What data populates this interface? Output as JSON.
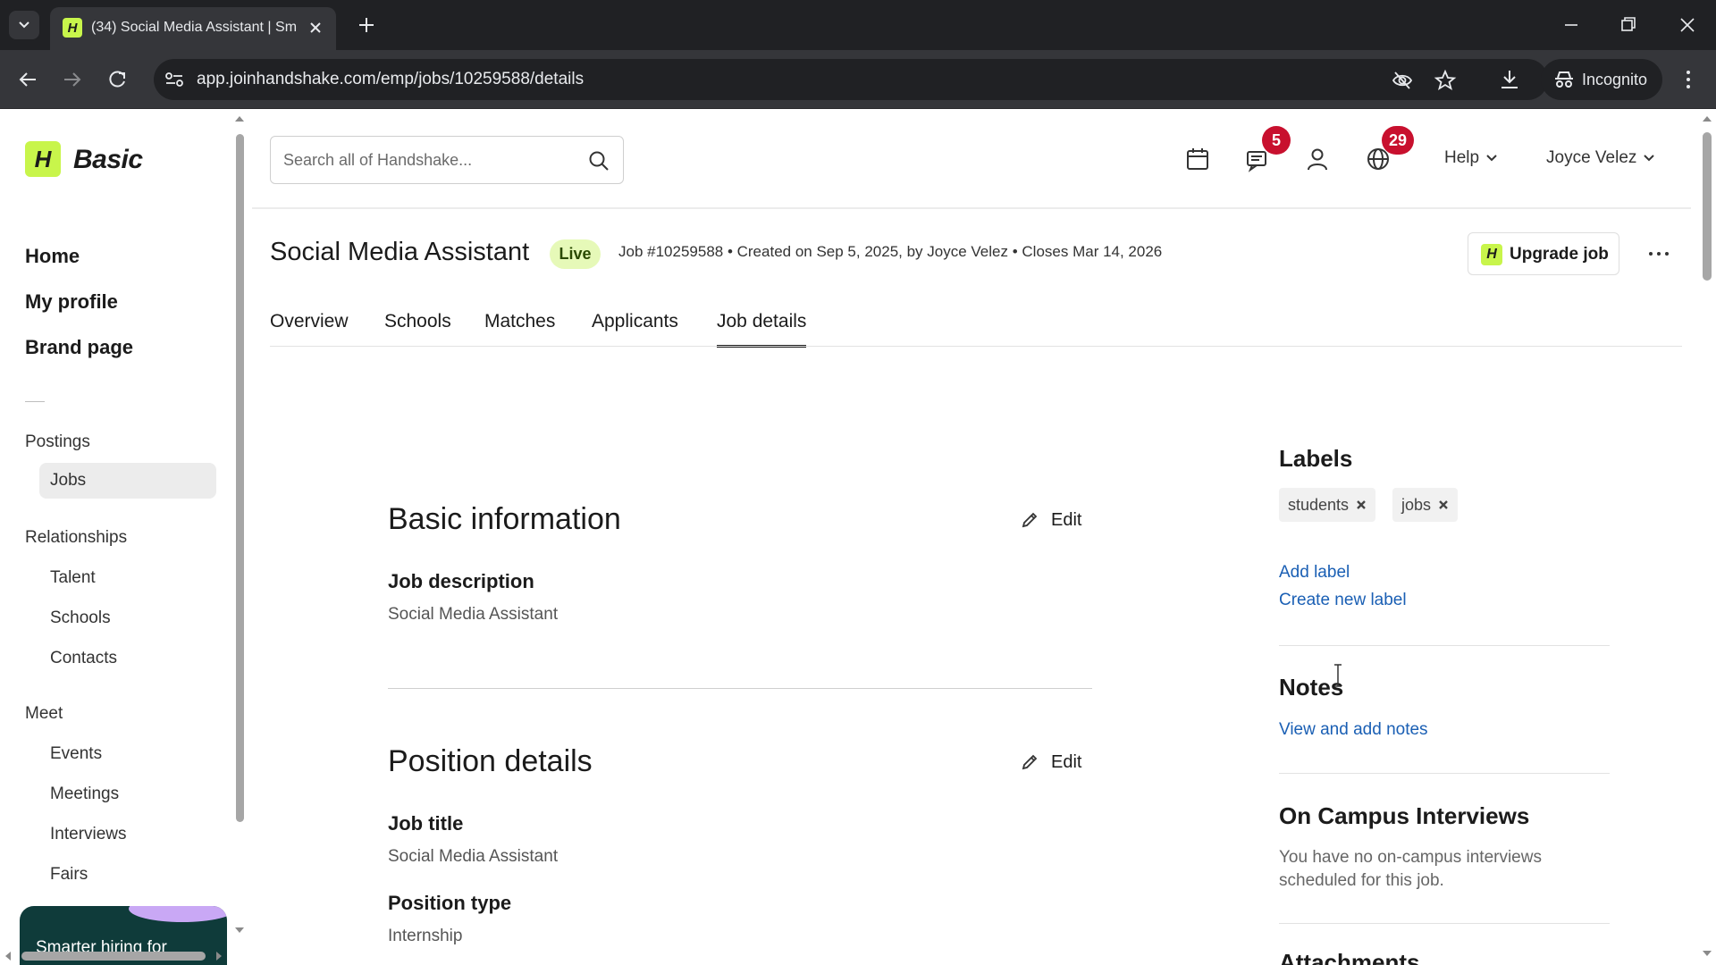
{
  "browser": {
    "tab_title": "(34) Social Media Assistant | Sm",
    "url": "app.joinhandshake.com/emp/jobs/10259588/details",
    "incognito_label": "Incognito"
  },
  "sidebar": {
    "brand_mark": "H",
    "brand_name": "Basic",
    "main": [
      {
        "label": "Home"
      },
      {
        "label": "My profile"
      },
      {
        "label": "Brand page"
      }
    ],
    "postings": {
      "title": "Postings",
      "items": [
        {
          "label": "Jobs"
        }
      ]
    },
    "relationships": {
      "title": "Relationships",
      "items": [
        {
          "label": "Talent"
        },
        {
          "label": "Schools"
        },
        {
          "label": "Contacts"
        }
      ]
    },
    "meet": {
      "title": "Meet",
      "items": [
        {
          "label": "Events"
        },
        {
          "label": "Meetings"
        },
        {
          "label": "Interviews"
        },
        {
          "label": "Fairs"
        }
      ]
    },
    "promo_text": "Smarter hiring for"
  },
  "header": {
    "search_placeholder": "Search all of Handshake...",
    "messages_badge": "5",
    "notifications_badge": "29",
    "help_label": "Help",
    "user_name": "Joyce Velez"
  },
  "job": {
    "title": "Social Media Assistant",
    "status": "Live",
    "meta": "Job #10259588 • Created on Sep 5, 2025, by Joyce Velez • Closes Mar 14, 2026",
    "upgrade_mark": "H",
    "upgrade_label": "Upgrade job",
    "tabs": [
      {
        "label": "Overview"
      },
      {
        "label": "Schools"
      },
      {
        "label": "Matches"
      },
      {
        "label": "Applicants"
      },
      {
        "label": "Job details"
      }
    ]
  },
  "basic_info": {
    "title": "Basic information",
    "edit_label": "Edit",
    "job_description_label": "Job description",
    "job_description_value": "Social Media Assistant"
  },
  "position_details": {
    "title": "Position details",
    "edit_label": "Edit",
    "job_title_label": "Job title",
    "job_title_value": "Social Media Assistant",
    "position_type_label": "Position type",
    "position_type_value": "Internship"
  },
  "right_panel": {
    "labels_title": "Labels",
    "labels": [
      "students",
      "jobs"
    ],
    "add_label": "Add label",
    "create_label": "Create new label",
    "notes_title": "Notes",
    "notes_link": "View and add notes",
    "interviews_title": "On Campus Interviews",
    "interviews_text": "You have no on-campus interviews scheduled for this job.",
    "attachments_title": "Attachments"
  },
  "colors": {
    "brand_accent": "#c8f54b",
    "badge_red": "#c8102e",
    "link_blue": "#1a5fb4",
    "live_bg": "#e6f9b8"
  }
}
